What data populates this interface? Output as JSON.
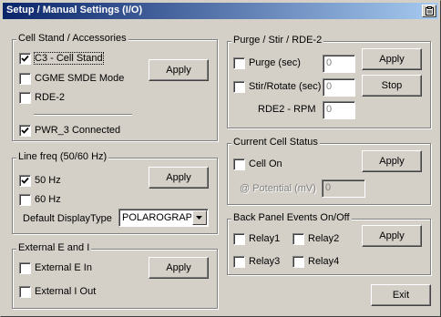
{
  "window": {
    "title": "Setup / Manual Settings (I/O)",
    "title_icon": "clipboard-icon"
  },
  "cell_stand": {
    "legend": "Cell Stand / Accessories",
    "options": [
      {
        "label": "C3 - Cell Stand",
        "checked": true
      },
      {
        "label": "CGME SMDE Mode",
        "checked": false
      },
      {
        "label": "RDE-2",
        "checked": false
      }
    ],
    "pwr": {
      "label": "PWR_3 Connected",
      "checked": true
    },
    "apply_label": "Apply"
  },
  "line_freq": {
    "legend": "Line freq (50/60 Hz)",
    "options": [
      {
        "label": "50 Hz",
        "checked": true
      },
      {
        "label": "60 Hz",
        "checked": false
      }
    ],
    "display_type_label": "Default DisplayType",
    "display_type_value": "POLAROGRAPHIC",
    "apply_label": "Apply"
  },
  "external": {
    "legend": "External E and I",
    "options": [
      {
        "label": "External E In",
        "checked": false
      },
      {
        "label": "External I Out",
        "checked": false
      }
    ],
    "apply_label": "Apply"
  },
  "purge": {
    "legend": "Purge / Stir / RDE-2",
    "purge_label": "Purge (sec)",
    "purge_value": "0",
    "stir_label": "Stir/Rotate (sec)",
    "stir_value": "0",
    "rpm_label": "RDE2 - RPM",
    "rpm_value": "0",
    "apply_label": "Apply",
    "stop_label": "Stop"
  },
  "cell_status": {
    "legend": "Current Cell Status",
    "cell_on_label": "Cell On",
    "potential_label": "@ Potential (mV)",
    "potential_value": "0",
    "apply_label": "Apply"
  },
  "back_panel": {
    "legend": "Back Panel Events On/Off",
    "relays": [
      {
        "label": "Relay1",
        "checked": false
      },
      {
        "label": "Relay2",
        "checked": false
      },
      {
        "label": "Relay3",
        "checked": false
      },
      {
        "label": "Relay4",
        "checked": false
      }
    ],
    "apply_label": "Apply"
  },
  "exit_label": "Exit"
}
